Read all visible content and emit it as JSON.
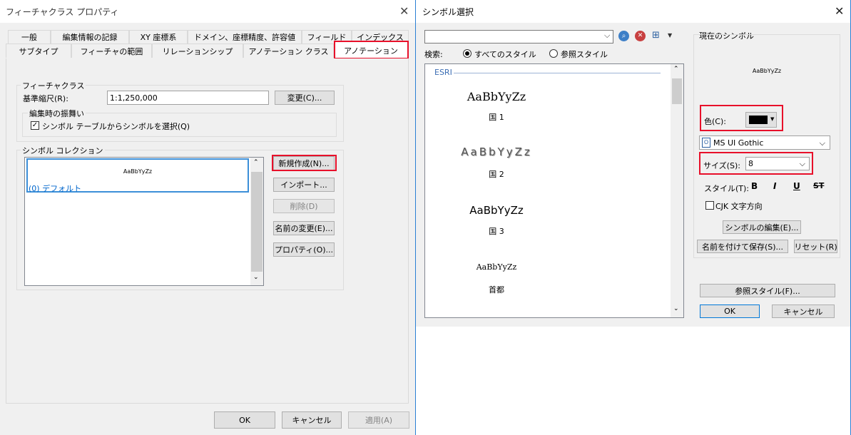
{
  "left_window": {
    "title": "フィーチャクラス プロパティ",
    "tabs_row1": [
      "一般",
      "編集情報の記録",
      "XY 座標系",
      "ドメイン、座標精度、許容値",
      "フィールド",
      "インデックス"
    ],
    "tabs_row2": [
      "サブタイプ",
      "フィーチャの範囲",
      "リレーションシップ",
      "アノテーション クラス",
      "アノテーション"
    ],
    "active_tab": "アノテーション",
    "featureclass_group": "フィーチャクラス",
    "ref_scale_label": "基準縮尺(R):",
    "ref_scale_value": "1:1,250,000",
    "change_button": "変更(C)...",
    "edit_behavior_group": "編集時の振舞い",
    "select_from_table_checkbox": "シンボル テーブルからシンボルを選択(Q)",
    "select_from_table_checked": true,
    "symbol_collection_group": "シンボル コレクション",
    "collection_preview": "AaBbYyZz",
    "collection_item": "(0) デフォルト",
    "new_button": "新規作成(N)...",
    "import_button": "インポート...",
    "delete_button": "削除(D)",
    "rename_button": "名前の変更(E)...",
    "properties_button": "プロパティ(O)...",
    "ok_button": "OK",
    "cancel_button": "キャンセル",
    "apply_button": "適用(A)"
  },
  "right_window": {
    "title": "シンボル選択",
    "search_value": "",
    "search_label": "検索:",
    "all_styles_radio": "すべてのスタイル",
    "ref_styles_radio": "参照スタイル",
    "all_styles_selected": true,
    "group_header": "ESRI",
    "symbols": [
      {
        "preview": "AaBbYyZz",
        "name": "国 1"
      },
      {
        "preview": "AaBbYyZz",
        "name": "国 2"
      },
      {
        "preview": "AaBbYyZz",
        "name": "国 3"
      },
      {
        "preview": "AaBbYyZz",
        "name": "首都"
      }
    ],
    "current_symbol_group": "現在のシンボル",
    "current_preview": "AaBbYyZz",
    "color_label": "色(C):",
    "color_value": "#000000",
    "font_value": "MS UI Gothic",
    "size_label": "サイズ(S):",
    "size_value": "8",
    "style_label": "スタイル(T):",
    "style_bold": "B",
    "style_italic": "I",
    "style_underline": "U",
    "style_strike": "ST",
    "cjk_checkbox": "CJK 文字方向",
    "cjk_checked": false,
    "edit_symbol_button": "シンボルの編集(E)...",
    "save_as_button": "名前を付けて保存(S)...",
    "reset_button": "リセット(R)",
    "ref_style_button": "参照スタイル(F)...",
    "ok_button": "OK",
    "cancel_button": "キャンセル"
  },
  "colors": {
    "highlight": "#e8102a",
    "selection_blue": "#3c8fd8",
    "link_blue": "#0066cc",
    "dialog_bg": "#f0f0f0"
  }
}
